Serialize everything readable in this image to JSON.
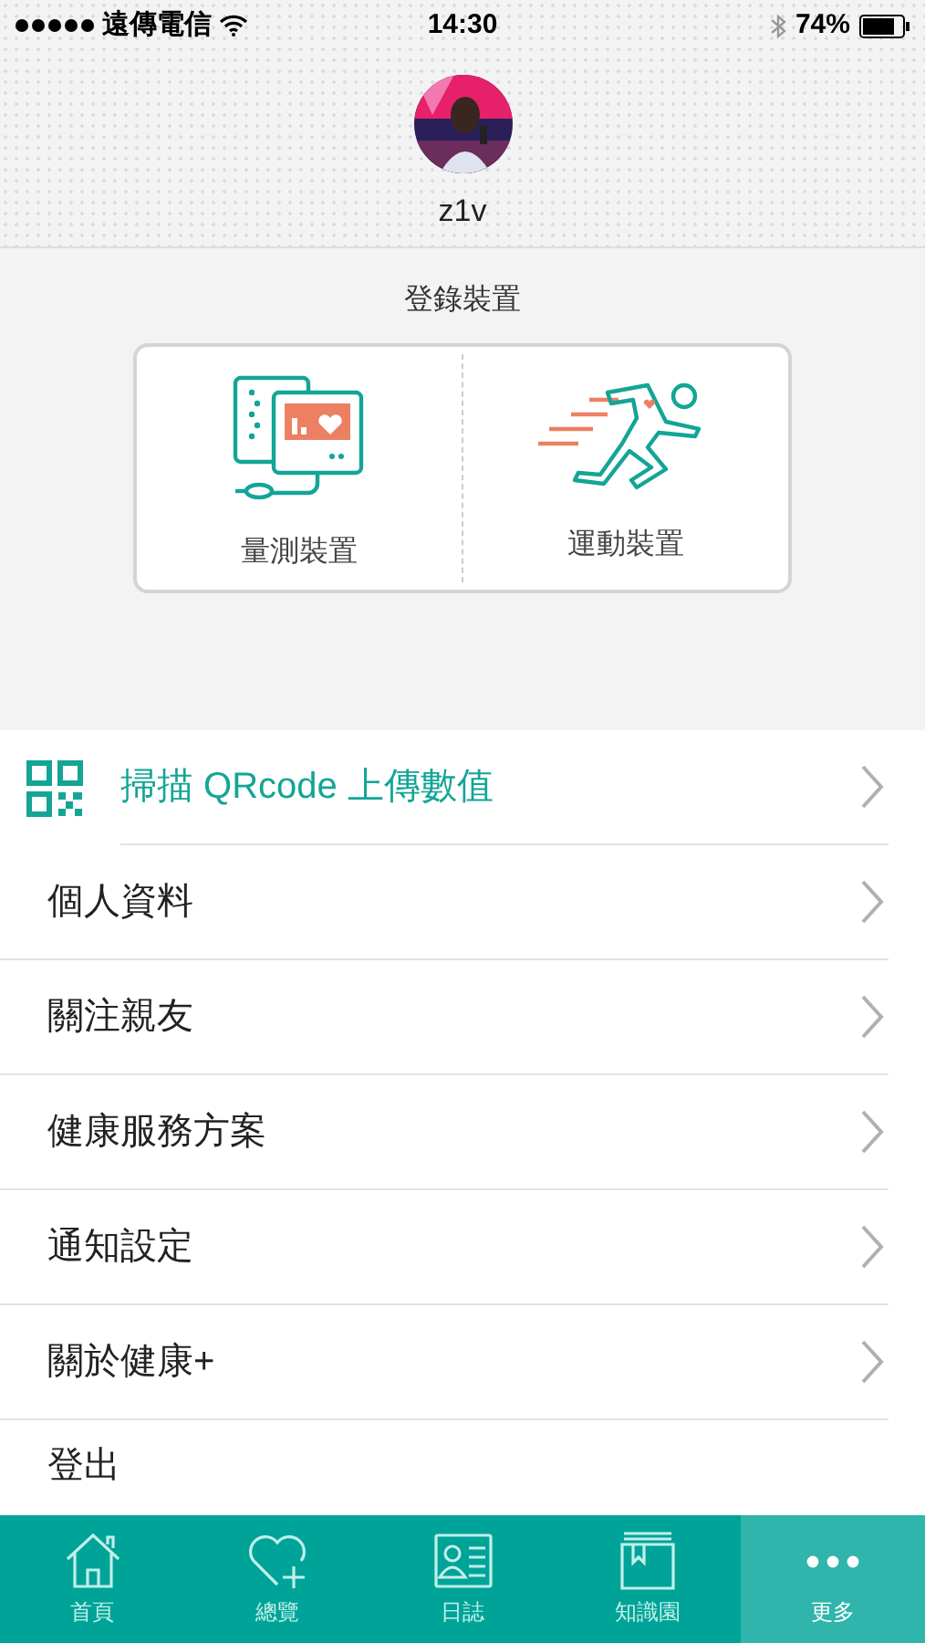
{
  "status_bar": {
    "carrier": "遠傳電信",
    "time": "14:30",
    "battery": "74%"
  },
  "profile": {
    "name": "z1v"
  },
  "devices": {
    "title": "登錄裝置",
    "items": [
      {
        "label": "量測裝置",
        "kind": "monitor"
      },
      {
        "label": "運動裝置",
        "kind": "runner"
      }
    ]
  },
  "menu": [
    {
      "label": "掃描 QRcode 上傳數值",
      "kind": "qr"
    },
    {
      "label": "個人資料",
      "kind": "plain"
    },
    {
      "label": "關注親友",
      "kind": "plain"
    },
    {
      "label": "健康服務方案",
      "kind": "plain"
    },
    {
      "label": "通知設定",
      "kind": "plain"
    },
    {
      "label": "關於健康+",
      "kind": "plain"
    },
    {
      "label": "登出",
      "kind": "last"
    }
  ],
  "tabs": [
    {
      "label": "首頁",
      "kind": "home",
      "selected": false
    },
    {
      "label": "總覽",
      "kind": "heart",
      "selected": false
    },
    {
      "label": "日誌",
      "kind": "card",
      "selected": false
    },
    {
      "label": "知識園",
      "kind": "book",
      "selected": false
    },
    {
      "label": "更多",
      "kind": "more",
      "selected": true
    }
  ]
}
